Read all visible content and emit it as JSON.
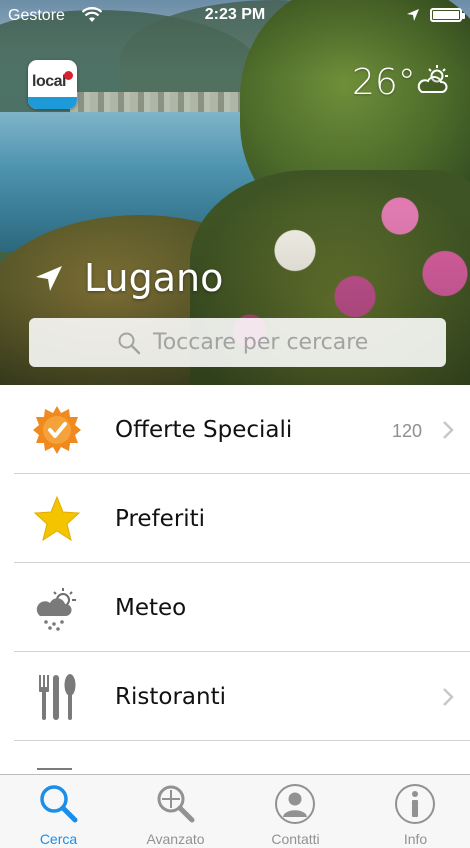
{
  "status_bar": {
    "carrier": "Gestore",
    "time": "2:23 PM"
  },
  "logo": {
    "text": "local"
  },
  "weather": {
    "temperature": "26°",
    "icon": "partly-cloudy-icon"
  },
  "location": {
    "city": "Lugano",
    "icon": "location-arrow-icon"
  },
  "search": {
    "placeholder": "Toccare per cercare"
  },
  "menu": [
    {
      "label": "Offerte Speciali",
      "count": "120",
      "icon": "special-offer-badge-icon",
      "has_chevron": true
    },
    {
      "label": "Preferiti",
      "count": "",
      "icon": "star-icon",
      "has_chevron": false
    },
    {
      "label": "Meteo",
      "count": "",
      "icon": "weather-icon",
      "has_chevron": false
    },
    {
      "label": "Ristoranti",
      "count": "",
      "icon": "cutlery-icon",
      "has_chevron": true
    }
  ],
  "tabs": [
    {
      "label": "Cerca",
      "icon": "search-icon",
      "active": true
    },
    {
      "label": "Avanzato",
      "icon": "advanced-search-icon",
      "active": false
    },
    {
      "label": "Contatti",
      "icon": "contacts-icon",
      "active": false
    },
    {
      "label": "Info",
      "icon": "info-icon",
      "active": false
    }
  ],
  "colors": {
    "active_tab": "#1a8ee8",
    "inactive_tab": "#929292",
    "offer_badge": "#f08a1e",
    "star": "#f5c400"
  }
}
